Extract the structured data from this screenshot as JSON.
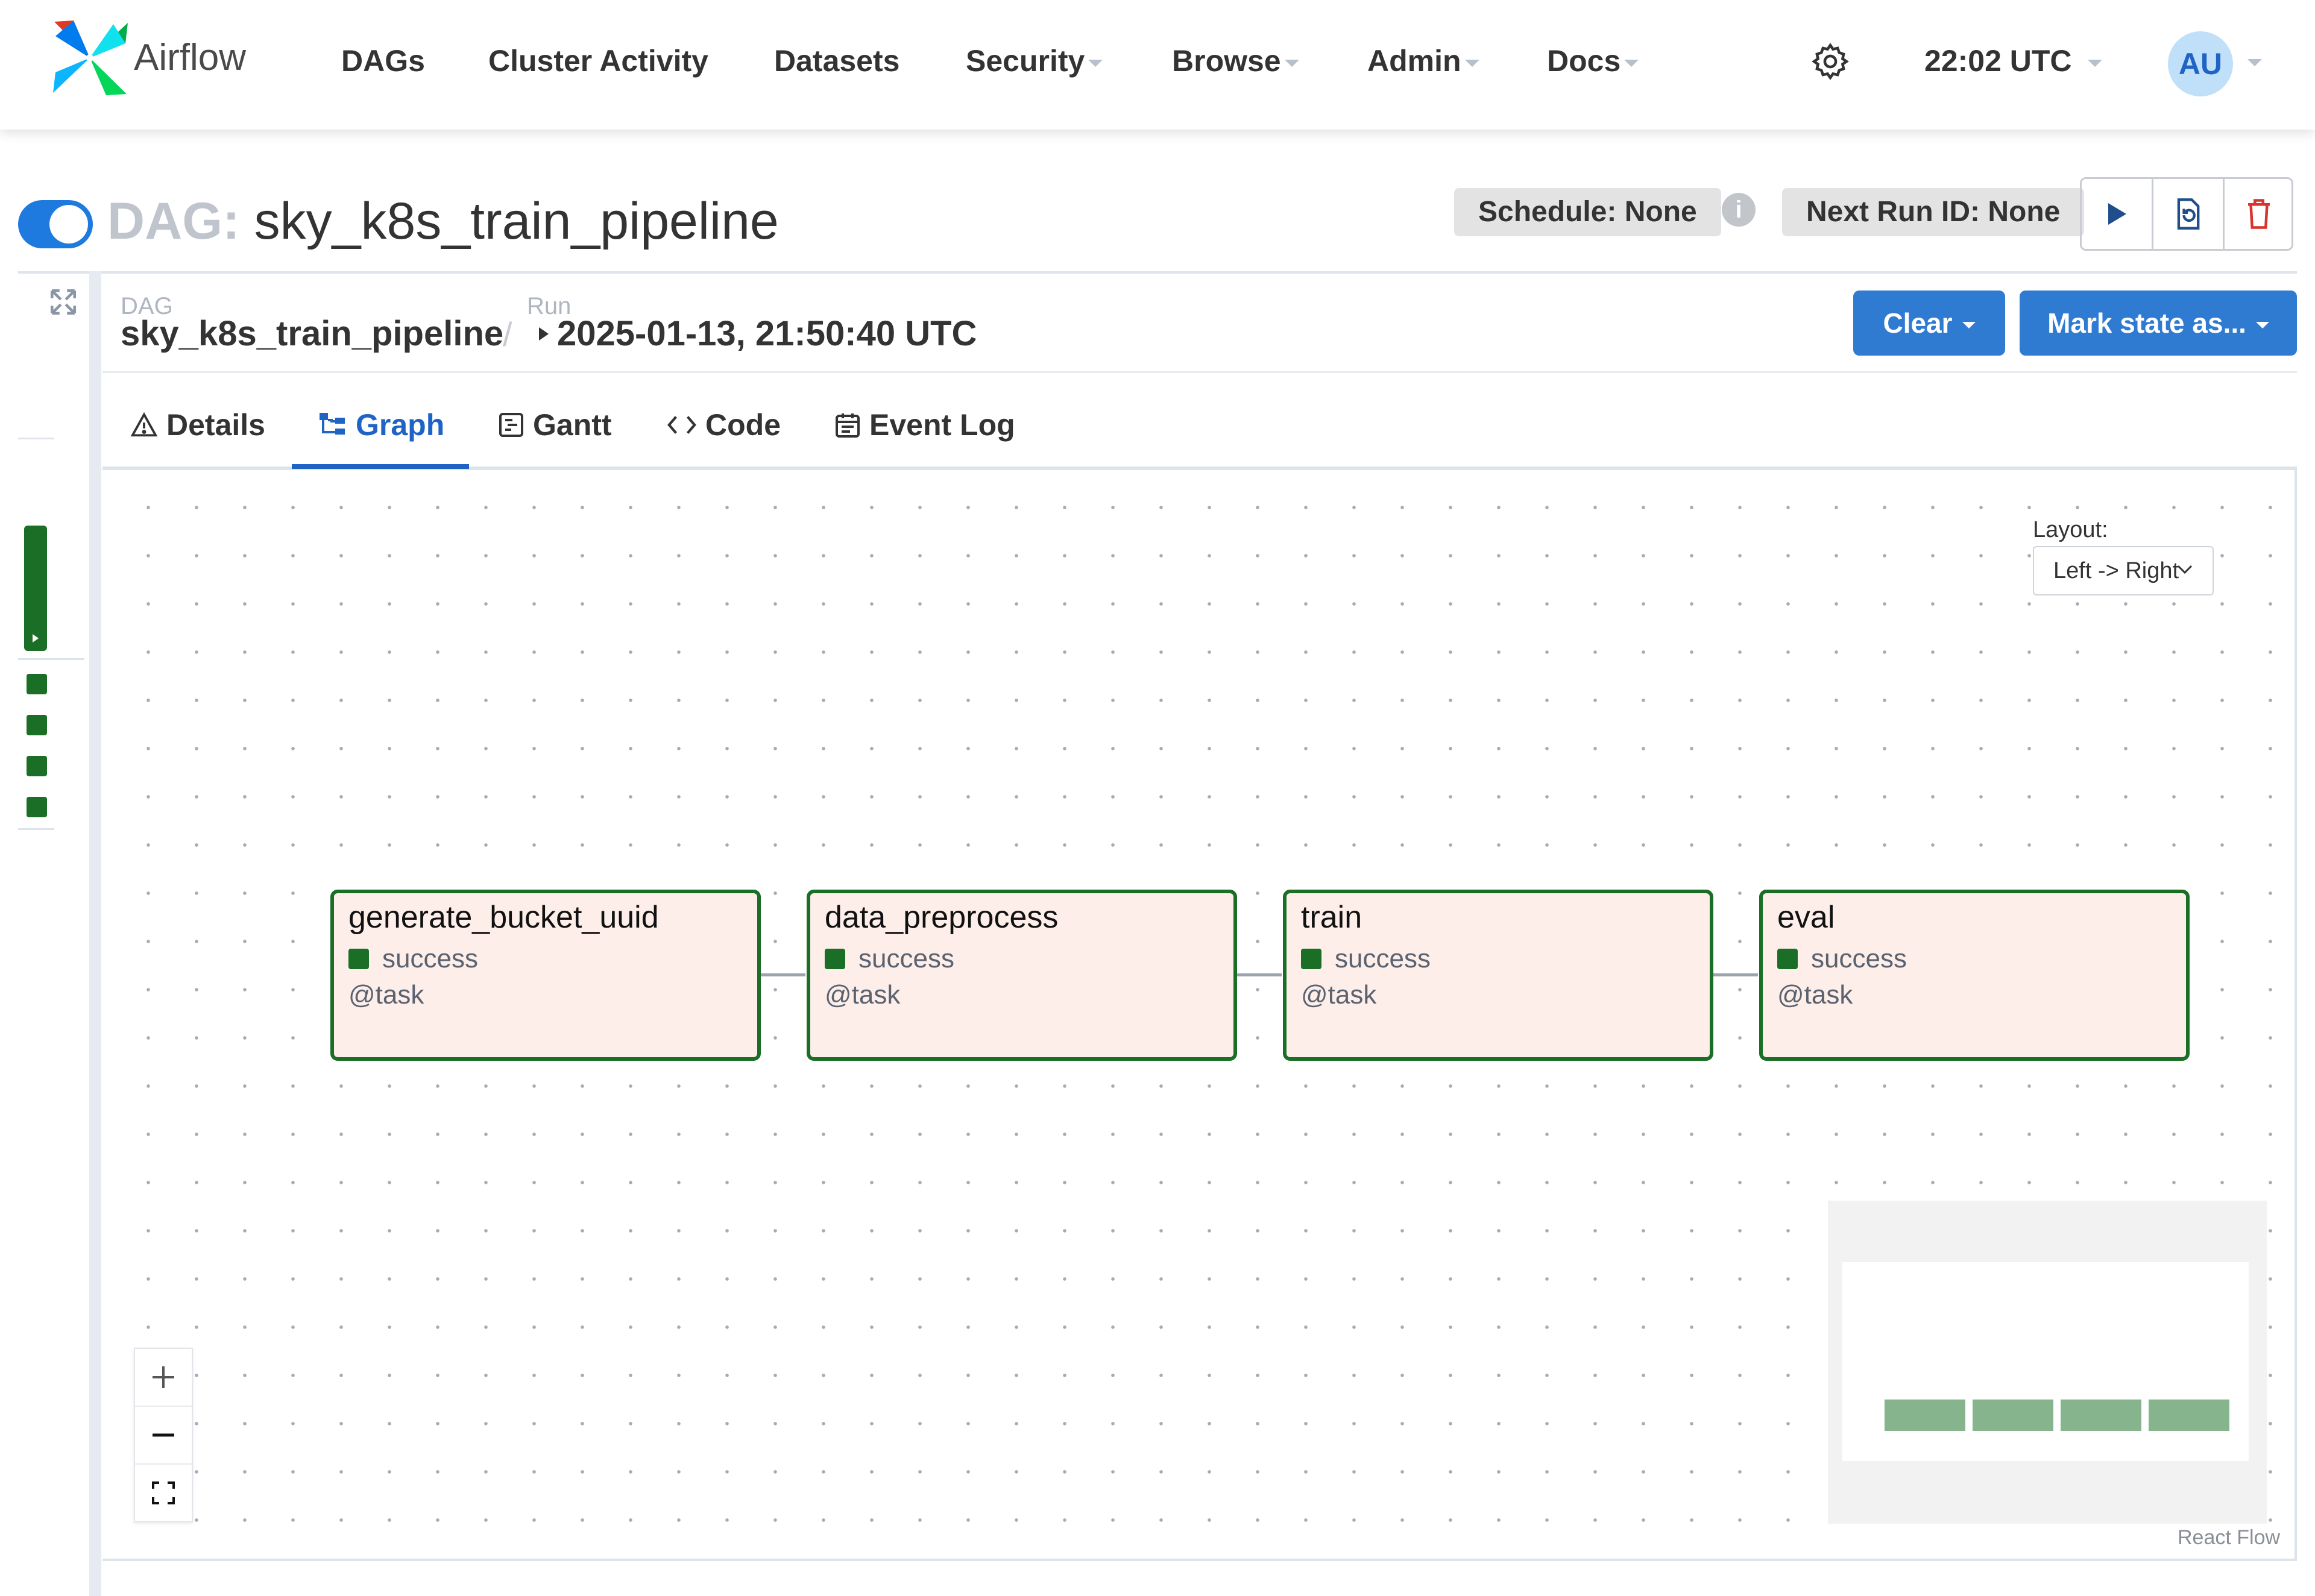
{
  "nav": {
    "brand": "Airflow",
    "items": [
      {
        "label": "DAGs",
        "dropdown": false
      },
      {
        "label": "Cluster Activity",
        "dropdown": false
      },
      {
        "label": "Datasets",
        "dropdown": false
      },
      {
        "label": "Security",
        "dropdown": true
      },
      {
        "label": "Browse",
        "dropdown": true
      },
      {
        "label": "Admin",
        "dropdown": true
      },
      {
        "label": "Docs",
        "dropdown": true
      }
    ],
    "time": "22:02 UTC",
    "avatar": "AU"
  },
  "header": {
    "prefix": "DAG:",
    "dag_id": "sky_k8s_train_pipeline",
    "schedule": "Schedule: None",
    "next_run": "Next Run ID: None",
    "paused": false
  },
  "breadcrumb": {
    "dag_label": "DAG",
    "dag_value": "sky_k8s_train_pipeline",
    "separator": "/",
    "run_label": "Run",
    "run_value": "2025-01-13, 21:50:40 UTC"
  },
  "actions": {
    "clear": "Clear",
    "mark_state": "Mark state as..."
  },
  "tabs": [
    {
      "label": "Details",
      "active": false,
      "icon": "warning-triangle-icon"
    },
    {
      "label": "Graph",
      "active": true,
      "icon": "graph-icon"
    },
    {
      "label": "Gantt",
      "active": false,
      "icon": "gantt-icon"
    },
    {
      "label": "Code",
      "active": false,
      "icon": "code-icon"
    },
    {
      "label": "Event Log",
      "active": false,
      "icon": "calendar-icon"
    }
  ],
  "graph": {
    "layout_label": "Layout:",
    "layout_value": "Left -> Right",
    "nodes": [
      {
        "title": "generate_bucket_uuid",
        "status": "success",
        "operator": "@task"
      },
      {
        "title": "data_preprocess",
        "status": "success",
        "operator": "@task"
      },
      {
        "title": "train",
        "status": "success",
        "operator": "@task"
      },
      {
        "title": "eval",
        "status": "success",
        "operator": "@task"
      }
    ],
    "attribution": "React Flow"
  },
  "colors": {
    "success": "#1a6e25",
    "accent": "#1f63c4",
    "button": "#2f7bd2",
    "node_bg": "#fdeee9"
  }
}
